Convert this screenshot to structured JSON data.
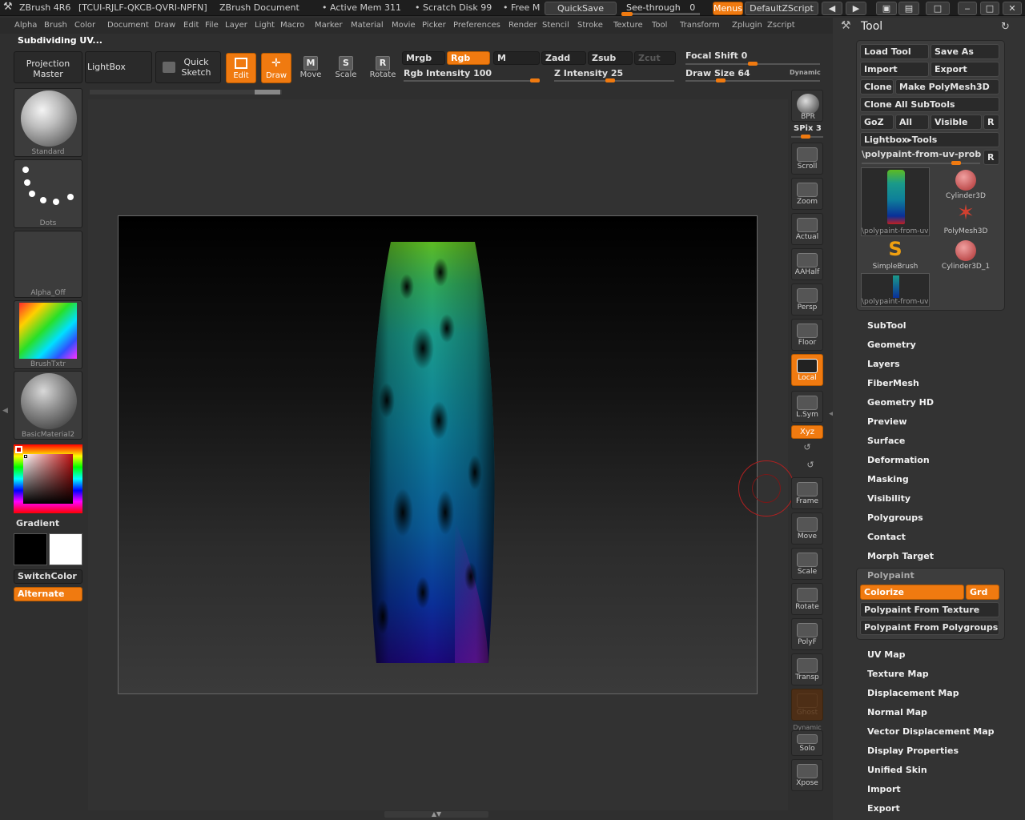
{
  "title_bar": {
    "app": "ZBrush 4R6",
    "license": "[TCUI-RJLF-QKCB-QVRI-NPFN]",
    "document": "ZBrush Document",
    "active_mem": "• Active Mem 311",
    "scratch_disk": "• Scratch Disk 99",
    "free": "• Free M",
    "quicksave": "QuickSave",
    "see_through_label": "See-through",
    "see_through_value": "0",
    "menus": "Menus",
    "default_zscript": "DefaultZScript"
  },
  "menu_items": [
    "Alpha",
    "Brush",
    "Color",
    "Document",
    "Draw",
    "Edit",
    "File",
    "Layer",
    "Light",
    "Macro",
    "Marker",
    "Material",
    "Movie",
    "Picker",
    "Preferences",
    "Render",
    "Stencil",
    "Stroke",
    "Texture",
    "Tool",
    "Transform",
    "Zplugin",
    "Zscript"
  ],
  "status_text": "Subdividing UV...",
  "top_shelf": {
    "projection_master_1": "Projection",
    "projection_master_2": "Master",
    "lightbox": "LightBox",
    "quick_sketch_1": "Quick",
    "quick_sketch_2": "Sketch",
    "edit": "Edit",
    "draw": "Draw",
    "move": "Move",
    "scale": "Scale",
    "rotate": "Rotate",
    "mrgb": "Mrgb",
    "rgb": "Rgb",
    "m": "M",
    "zadd": "Zadd",
    "zsub": "Zsub",
    "zcut": "Zcut",
    "rgb_intensity_label": "Rgb Intensity",
    "rgb_intensity_value": "100",
    "z_intensity_label": "Z Intensity",
    "z_intensity_value": "25",
    "focal_shift_label": "Focal Shift",
    "focal_shift_value": "0",
    "draw_size_label": "Draw Size",
    "draw_size_value": "64",
    "dynamic": "Dynamic"
  },
  "left_tray": {
    "brush": "Standard",
    "stroke": "Dots",
    "alpha": "Alpha_Off",
    "texture": "BrushTxtr",
    "material": "BasicMaterial2",
    "gradient": "Gradient",
    "switch_color": "SwitchColor",
    "alternate": "Alternate"
  },
  "right_shelf": {
    "bpr": "BPR",
    "spix_label": "SPix",
    "spix_value": "3",
    "scroll": "Scroll",
    "zoom": "Zoom",
    "actual": "Actual",
    "aahalf": "AAHalf",
    "persp": "Persp",
    "floor": "Floor",
    "local": "Local",
    "lsym": "L.Sym",
    "xyz": "Xyz",
    "frame": "Frame",
    "move": "Move",
    "scale": "Scale",
    "rotate": "Rotate",
    "polyf": "PolyF",
    "transp": "Transp",
    "ghost": "Ghost",
    "dynamic": "Dynamic",
    "solo": "Solo",
    "xpose": "Xpose"
  },
  "tool_panel": {
    "title": "Tool",
    "load_tool": "Load Tool",
    "save_as": "Save As",
    "import": "Import",
    "export": "Export",
    "clone": "Clone",
    "make_polymesh": "Make PolyMesh3D",
    "clone_all": "Clone All SubTools",
    "goz": "GoZ",
    "all": "All",
    "visible": "Visible",
    "r": "R",
    "lightbox_tools": "Lightbox▸Tools",
    "current_tool": "\\polypaint-from-uv-proble",
    "current_tool_thumb": "\\polypaint-from-uv",
    "subtools": [
      "Cylinder3D",
      "PolyMesh3D",
      "SimpleBrush",
      "Cylinder3D_1"
    ],
    "bottom_thumb": "\\polypaint-from-uv",
    "sections_top": [
      "SubTool",
      "Geometry",
      "Layers",
      "FiberMesh",
      "Geometry HD",
      "Preview",
      "Surface",
      "Deformation",
      "Masking",
      "Visibility",
      "Polygroups",
      "Contact",
      "Morph Target"
    ],
    "polypaint": "Polypaint",
    "colorize": "Colorize",
    "grd": "Grd",
    "polypaint_from_texture": "Polypaint From Texture",
    "polypaint_from_polygroups": "Polypaint From Polygroups",
    "sections_bottom": [
      "UV Map",
      "Texture Map",
      "Displacement Map",
      "Normal Map",
      "Vector Displacement Map",
      "Display Properties",
      "Unified Skin",
      "Import",
      "Export"
    ]
  },
  "colors": {
    "accent": "#f07a10",
    "panel": "#333333",
    "canvas": "#323232"
  }
}
